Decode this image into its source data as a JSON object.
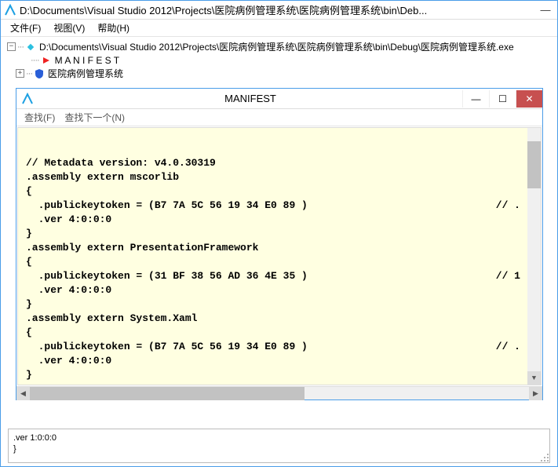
{
  "main_window": {
    "title": "D:\\Documents\\Visual Studio 2012\\Projects\\医院病例管理系统\\医院病例管理系统\\bin\\Deb...",
    "minimize_glyph": "—"
  },
  "menu": {
    "file": "文件(F)",
    "view": "视图(V)",
    "help": "帮助(H)"
  },
  "tree": {
    "root_label": "D:\\Documents\\Visual Studio 2012\\Projects\\医院病例管理系统\\医院病例管理系统\\bin\\Debug\\医院病例管理系统.exe",
    "manifest_label": "M A N I F E S T",
    "module_label": "医院病例管理系统"
  },
  "child_window": {
    "title": "MANIFEST",
    "menu": {
      "find": "查找(F)",
      "find_next": "查找下一个(N)"
    }
  },
  "code_lines": [
    {
      "text": "// Metadata version: v4.0.30319",
      "cmt": ""
    },
    {
      "text": ".assembly extern mscorlib",
      "cmt": ""
    },
    {
      "text": "{",
      "cmt": ""
    },
    {
      "text": "  .publickeytoken = (B7 7A 5C 56 19 34 E0 89 )",
      "cmt": "// ."
    },
    {
      "text": "  .ver 4:0:0:0",
      "cmt": ""
    },
    {
      "text": "}",
      "cmt": ""
    },
    {
      "text": ".assembly extern PresentationFramework",
      "cmt": ""
    },
    {
      "text": "{",
      "cmt": ""
    },
    {
      "text": "  .publickeytoken = (31 BF 38 56 AD 36 4E 35 )",
      "cmt": "// 1"
    },
    {
      "text": "  .ver 4:0:0:0",
      "cmt": ""
    },
    {
      "text": "}",
      "cmt": ""
    },
    {
      "text": ".assembly extern System.Xaml",
      "cmt": ""
    },
    {
      "text": "{",
      "cmt": ""
    },
    {
      "text": "  .publickeytoken = (B7 7A 5C 56 19 34 E0 89 )",
      "cmt": "// ."
    },
    {
      "text": "  .ver 4:0:0:0",
      "cmt": ""
    },
    {
      "text": "}",
      "cmt": ""
    }
  ],
  "bottom_pane": {
    "line1": ".ver 1:0:0:0",
    "line2": "}"
  }
}
